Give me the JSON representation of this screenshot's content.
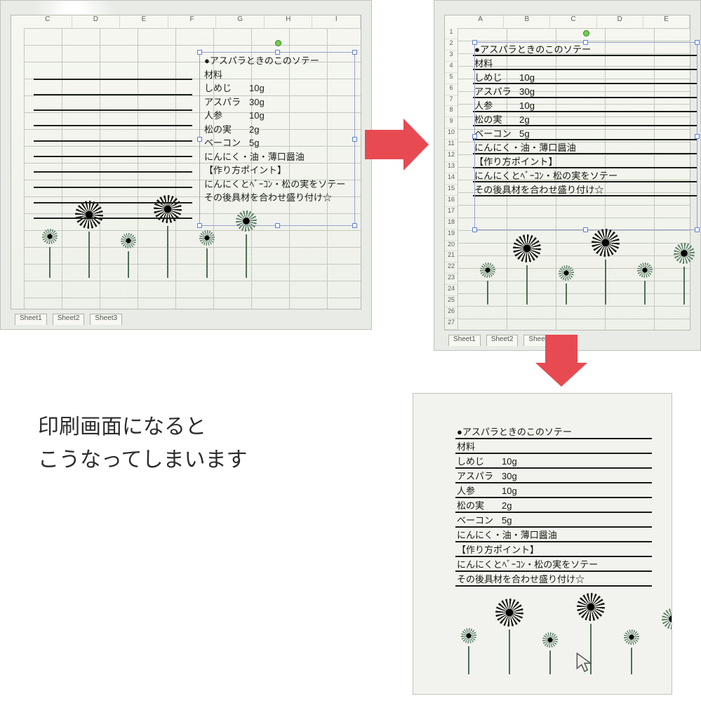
{
  "caption": {
    "line1": "印刷画面になると",
    "line2": "こうなってしまいます"
  },
  "columns_p1": [
    "C",
    "D",
    "E",
    "F",
    "G",
    "H",
    "I"
  ],
  "columns_p2": [
    "A",
    "B",
    "C",
    "D",
    "E"
  ],
  "rows_p2": [
    "1",
    "2",
    "3",
    "4",
    "5",
    "6",
    "7",
    "8",
    "9",
    "10",
    "11",
    "12",
    "13",
    "14",
    "15",
    "16",
    "17",
    "18",
    "19",
    "20",
    "21",
    "22",
    "23",
    "24",
    "25",
    "26",
    "27"
  ],
  "sheet_tabs": [
    "Sheet1",
    "Sheet2",
    "Sheet3"
  ],
  "recipe": {
    "title": "●アスパラときのこのソテー",
    "section_ingredients": "材料",
    "ingredients": [
      {
        "name": "しめじ",
        "amount": "10g"
      },
      {
        "name": "アスパラ",
        "amount": "30g"
      },
      {
        "name": "人参",
        "amount": "10g"
      },
      {
        "name": "松の実",
        "amount": "2g"
      },
      {
        "name": "ベーコン",
        "amount": "5g"
      }
    ],
    "seasoning": "にんにく・油・薄口醤油",
    "section_method": "【作り方ポイント】",
    "step1": "にんにくとﾍﾞｰｺﾝ・松の実をソテー",
    "step2": "その後具材を合わせ盛り付け☆"
  },
  "icons": {
    "cursor": "cursor-icon",
    "rotate": "rotate-handle-icon"
  }
}
